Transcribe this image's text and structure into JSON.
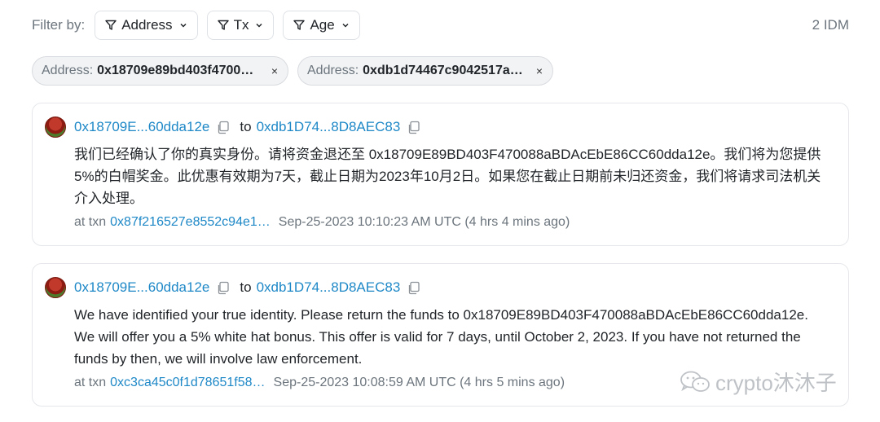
{
  "filter": {
    "label": "Filter by:",
    "buttons": [
      {
        "label": "Address",
        "icon": "funnel-icon"
      },
      {
        "label": "Tx",
        "icon": "funnel-icon"
      },
      {
        "label": "Age",
        "icon": "funnel-icon"
      }
    ],
    "count": "2 IDM"
  },
  "chips": [
    {
      "key": "Address:",
      "value": "0x18709e89bd403f4700…",
      "close": "×"
    },
    {
      "key": "Address:",
      "value": "0xdb1d74467c9042517a…",
      "close": "×"
    }
  ],
  "messages": [
    {
      "from": "0x18709E...60dda12e",
      "to_word": "to",
      "to": "0xdb1D74...8D8AEC83",
      "text": "我们已经确认了你的真实身份。请将资金退还至 0x18709E89BD403F470088aBDAcEbE86CC60dda12e。我们将为您提供5%的白帽奖金。此优惠有效期为7天，截止日期为2023年10月2日。如果您在截止日期前未归还资金，我们将请求司法机关介入处理。",
      "at_txn_label": "at txn",
      "txn": "0x87f216527e8552c94e1…",
      "time": "Sep-25-2023 10:10:23 AM UTC (4 hrs 4 mins ago)"
    },
    {
      "from": "0x18709E...60dda12e",
      "to_word": "to",
      "to": "0xdb1D74...8D8AEC83",
      "text": "We have identified your true identity. Please return the funds to 0x18709E89BD403F470088aBDAcEbE86CC60dda12e. We will offer you a 5% white hat bonus. This offer is valid for 7 days, until October 2, 2023. If you have not returned the funds by then, we will involve law enforcement.",
      "at_txn_label": "at txn",
      "txn": "0xc3ca45c0f1d78651f58…",
      "time": "Sep-25-2023 10:08:59 AM UTC (4 hrs 5 mins ago)"
    }
  ],
  "watermark": {
    "text": "crypto沐沐子",
    "icon": "wechat-icon"
  },
  "colors": {
    "link": "#1e88c7",
    "muted": "#6c757d",
    "border": "#e5e7ea"
  }
}
